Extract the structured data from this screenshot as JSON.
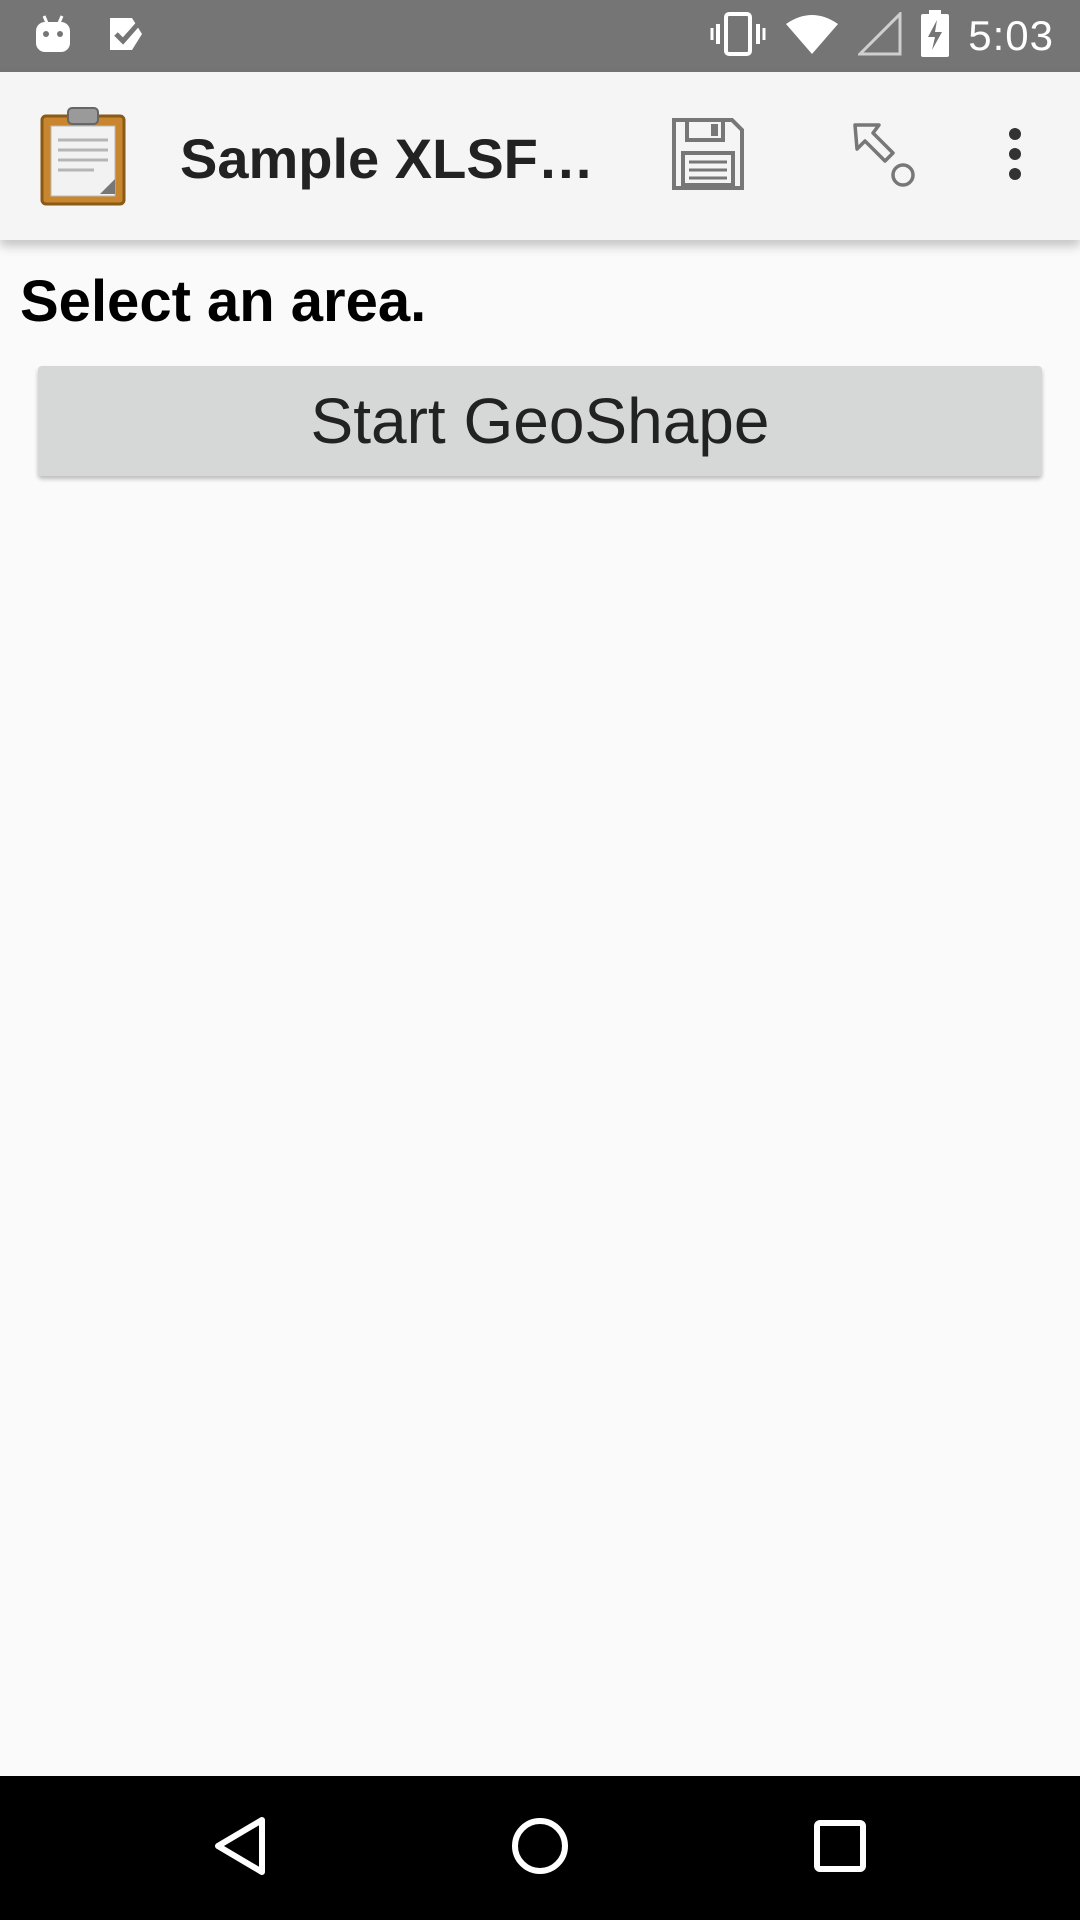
{
  "status_bar": {
    "time": "5:03",
    "left_icons": [
      "android-icon",
      "check-task-icon"
    ],
    "right_icons": [
      "vibrate-icon",
      "wifi-icon",
      "cell-signal-icon",
      "battery-charging-icon"
    ]
  },
  "action_bar": {
    "title": "Sample XLSForm",
    "app_icon": "clipboard-icon",
    "actions": [
      "save-icon",
      "jump-icon",
      "overflow-menu-icon"
    ]
  },
  "question": {
    "label": "Select an area.",
    "button_label": "Start GeoShape"
  },
  "nav_bar": {
    "buttons": [
      "back-icon",
      "home-icon",
      "recents-icon"
    ]
  },
  "colors": {
    "status_bar": "#757575",
    "action_bar": "#f5f5f5",
    "background": "#fafafa",
    "button": "#d6d7d7",
    "nav_bar": "#000000"
  }
}
